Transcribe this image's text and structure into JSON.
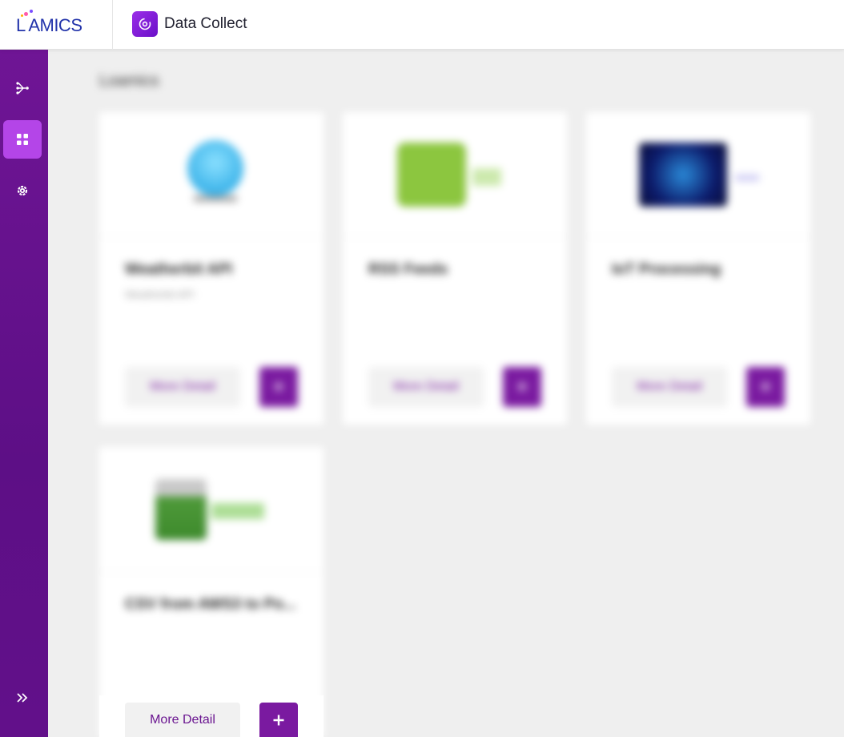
{
  "header": {
    "logo_text": "L AMICS",
    "app_title": "Data Collect"
  },
  "sidebar": {
    "items": [
      {
        "icon": "flow-icon",
        "active": false
      },
      {
        "icon": "apps-grid-icon",
        "active": true
      },
      {
        "icon": "gear-icon",
        "active": false
      },
      {
        "icon": "double-chevron-right-icon",
        "active": false
      }
    ]
  },
  "main": {
    "section_title": "Loamics",
    "cards": [
      {
        "name": "Weatherbit API",
        "subtitle": "Weatherbit API",
        "detail_label": "More Detail",
        "add_label": "+"
      },
      {
        "name": "RSS Feeds",
        "subtitle": "",
        "detail_label": "More Detail",
        "add_label": "+"
      },
      {
        "name": "IoT Processing",
        "subtitle": "",
        "detail_label": "More Detail",
        "add_label": "+"
      },
      {
        "name": "CSV from AWS3 to Po...",
        "subtitle": "",
        "detail_label": "More Detail",
        "add_label": "+"
      }
    ]
  },
  "colors": {
    "sidebar": "#6a1290",
    "active_nav": "#b445e8",
    "primary": "#7a1aa0",
    "background": "#efefef"
  }
}
